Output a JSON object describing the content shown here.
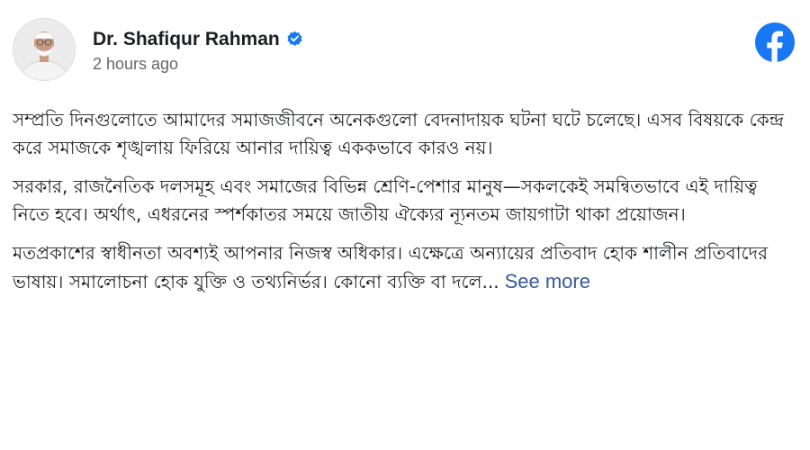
{
  "post": {
    "author": "Dr. Shafiqur Rahman",
    "verified": true,
    "timestamp": "2 hours ago",
    "paragraphs": [
      "সম্প্রতি দিনগুলোতে আমাদের সমাজজীবনে অনেকগুলো বেদনাদায়ক ঘটনা ঘটে চলেছে। এসব বিষয়কে কেন্দ্র করে সমাজকে শৃঙ্খলায় ফিরিয়ে আনার দায়িত্ব এককভাবে কারও নয়।",
      "সরকার, রাজনৈতিক দলসমূহ এবং সমাজের বিভিন্ন শ্রেণি-পেশার মানুষ—সকলকেই সমন্বিতভাবে এই দায়িত্ব নিতে হবে। অর্থাৎ, এধরনের স্পর্শকাতর সময়ে জাতীয় ঐক্যের ন্যূনতম জায়গাটা থাকা প্রয়োজন।"
    ],
    "last_paragraph": "মতপ্রকাশের স্বাধীনতা অবশ্যই আপনার নিজস্ব অধিকার। এক্ষেত্রে অন্যায়ের প্রতিবাদ হোক শালীন প্রতিবাদের ভাষায়। সমালোচনা হোক যুক্তি ও তথ্যনির্ভর। কোনো ব্যক্তি বা দলে...",
    "see_more": "See more"
  },
  "icons": {
    "verified": "verified-badge-icon",
    "platform": "facebook-logo-icon"
  },
  "colors": {
    "facebook_blue": "#1877f2",
    "link": "#385898",
    "secondary_text": "#65676b"
  }
}
